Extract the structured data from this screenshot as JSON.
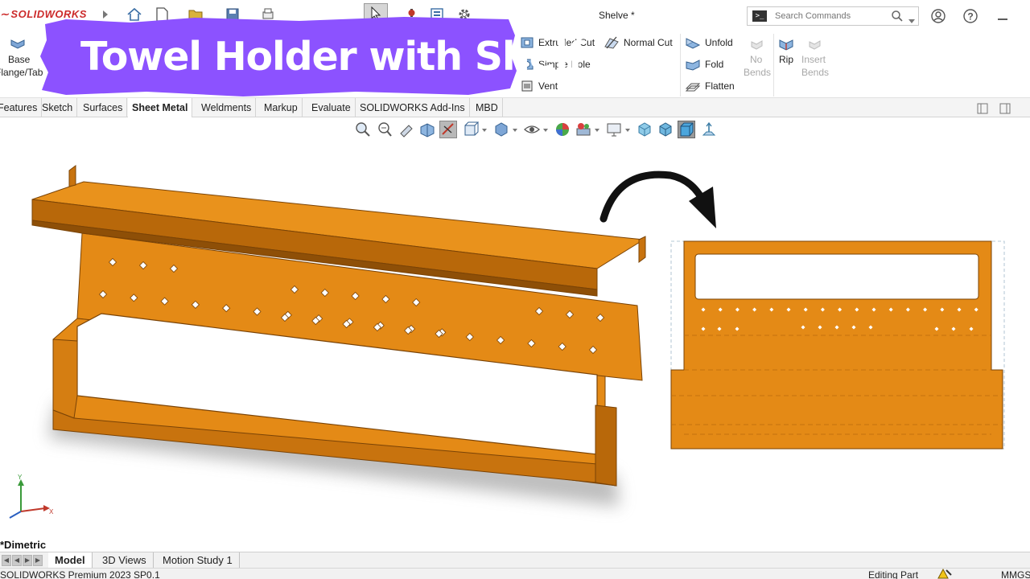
{
  "app": {
    "logo_text": "SOLIDWORKS",
    "document_title": "Shelve *"
  },
  "search": {
    "placeholder": "Search Commands"
  },
  "banner": {
    "text": "Towel Holder with Shelf",
    "color": "#8c52ff"
  },
  "ribbon": {
    "base_flange_line1": "Base",
    "base_flange_line2": "Flange/Tab",
    "extruded_cut": "Extruded Cut",
    "normal_cut": "Normal Cut",
    "simple_hole": "Simple Hole",
    "vent": "Vent",
    "unfold": "Unfold",
    "fold": "Fold",
    "flatten": "Flatten",
    "no_bends_line1": "No",
    "no_bends_line2": "Bends",
    "rip": "Rip",
    "insert_bends_line1": "Insert",
    "insert_bends_line2": "Bends"
  },
  "tabs": [
    {
      "label": "Features"
    },
    {
      "label": "Sketch"
    },
    {
      "label": "Surfaces"
    },
    {
      "label": "Sheet Metal"
    },
    {
      "label": "Weldments"
    },
    {
      "label": "Markup"
    },
    {
      "label": "Evaluate"
    },
    {
      "label": "SOLIDWORKS Add-Ins"
    },
    {
      "label": "MBD"
    }
  ],
  "active_tab": "Sheet Metal",
  "view": {
    "orientation_label": "*Dimetric"
  },
  "bottom_tabs": [
    {
      "label": "Model"
    },
    {
      "label": "3D Views"
    },
    {
      "label": "Motion Study 1"
    }
  ],
  "status": {
    "product": "SOLIDWORKS Premium 2023 SP0.1",
    "mode": "Editing Part",
    "units": "MMGS"
  },
  "colors": {
    "part_orange": "#e48a16",
    "part_dark": "#a85c08",
    "part_mid": "#c8730e",
    "brand_red": "#cc2b2b",
    "arrow": "#111111"
  },
  "triad_axes": {
    "x": "X",
    "y": "Y"
  }
}
